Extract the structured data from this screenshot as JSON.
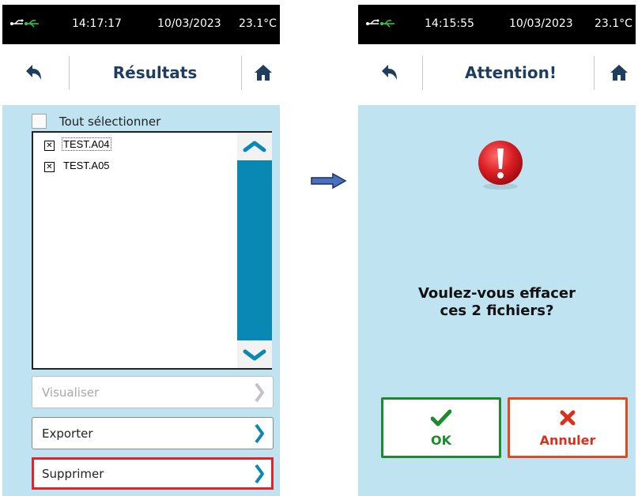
{
  "left_screen": {
    "status": {
      "time": "14:17:17",
      "date": "10/03/2023",
      "temperature": "23.1°C",
      "usb_icon": "usb-icon"
    },
    "title": "Résultats",
    "select_all_label": "Tout sélectionner",
    "select_all_checked": false,
    "files": [
      {
        "name": "TEST.A04",
        "checked": true,
        "focused": true
      },
      {
        "name": "TEST.A05",
        "checked": true,
        "focused": false
      }
    ],
    "menu": {
      "visualiser": {
        "label": "Visualiser",
        "enabled": false
      },
      "exporter": {
        "label": "Exporter",
        "enabled": true
      },
      "supprimer": {
        "label": "Supprimer",
        "enabled": true,
        "highlighted": true
      }
    }
  },
  "right_screen": {
    "status": {
      "time": "14:15:55",
      "date": "10/03/2023",
      "temperature": "23.1°C",
      "usb_icon": "usb-icon"
    },
    "title": "Attention!",
    "message_line1": "Voulez-vous effacer",
    "message_line2": "ces 2 fichiers?",
    "ok_label": "OK",
    "cancel_label": "Annuler"
  },
  "colors": {
    "content_bg": "#bfe3f0",
    "title_text": "#1f3e5e",
    "scrollbar": "#0a88b4",
    "highlight_border": "#e2232a",
    "ok_green": "#1d8a2b",
    "cancel_red": "#e24a1e",
    "usb_green": "#32d14c"
  }
}
